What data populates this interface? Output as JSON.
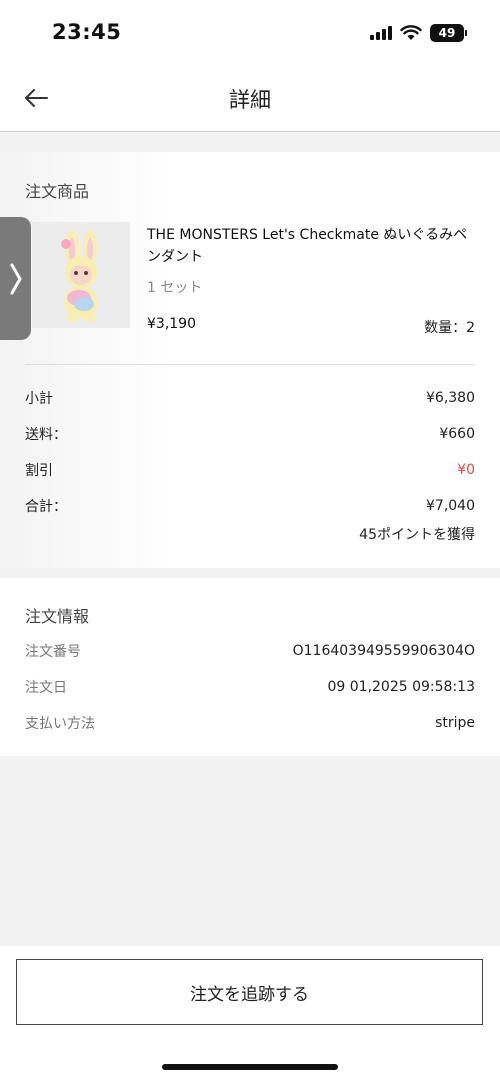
{
  "status_bar": {
    "time": "23:45",
    "battery": "49"
  },
  "nav": {
    "title": "詳細"
  },
  "order_items": {
    "section_title": "注文商品",
    "product": {
      "name": "THE MONSTERS Let's Checkmate ぬいぐるみペンダント",
      "set": "1 セット",
      "price": "¥3,190",
      "quantity": "数量：2"
    },
    "summary": {
      "subtotal_label": "小計",
      "subtotal_value": "¥6,380",
      "shipping_label": "送料：",
      "shipping_value": "¥660",
      "discount_label": "割引",
      "discount_value": "¥0",
      "total_label": "合計：",
      "total_value": "¥7,040",
      "points": "45ポイントを獲得"
    }
  },
  "order_info": {
    "section_title": "注文情報",
    "rows": [
      {
        "label": "注文番号",
        "value": "O116403949559906304O"
      },
      {
        "label": "注文日",
        "value": "09 01,2025 09:58:13"
      },
      {
        "label": "支払い方法",
        "value": "stripe"
      }
    ]
  },
  "actions": {
    "track_label": "注文を追跡する"
  },
  "colors": {
    "discount": "#e24a4a",
    "background": "#f2f2f2"
  }
}
